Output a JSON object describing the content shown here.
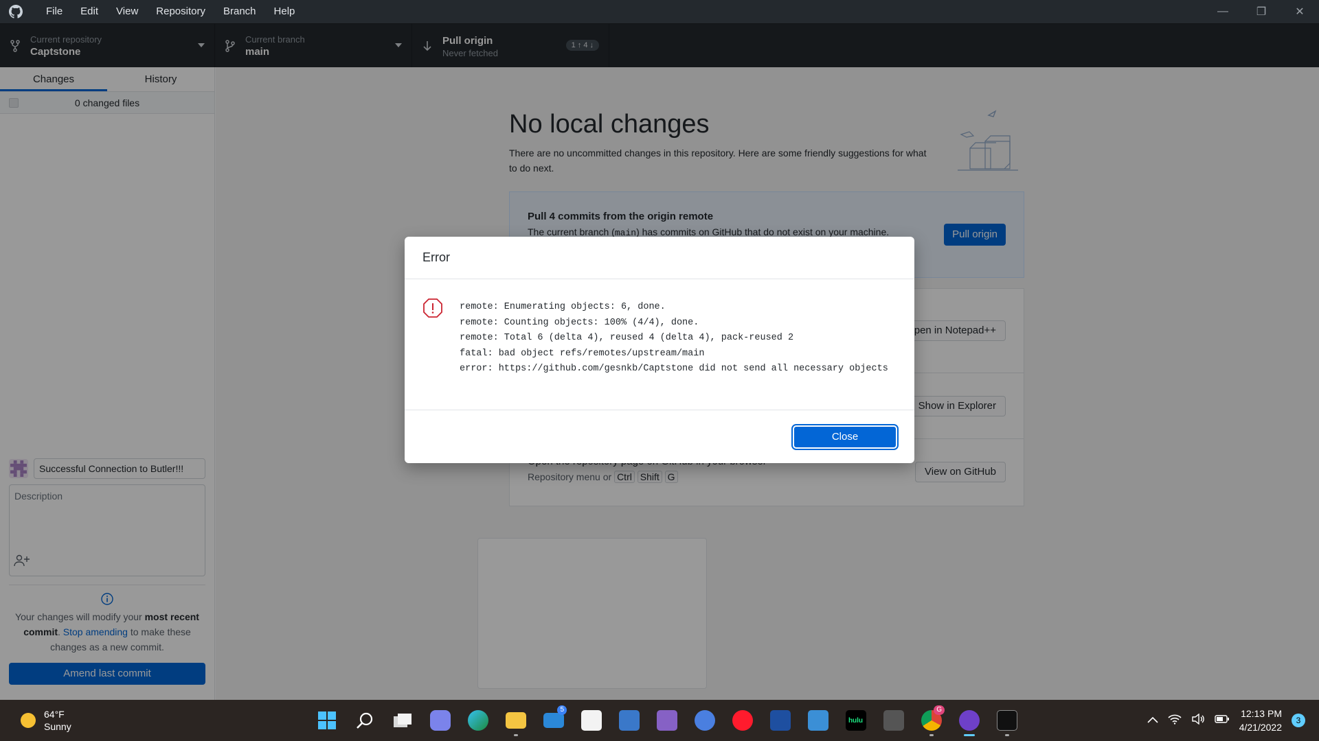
{
  "menu": [
    "File",
    "Edit",
    "View",
    "Repository",
    "Branch",
    "Help"
  ],
  "toolbar": {
    "repo_label": "Current repository",
    "repo_value": "Captstone",
    "branch_label": "Current branch",
    "branch_value": "main",
    "pull_label": "Pull origin",
    "pull_value": "Never fetched",
    "pull_badge": "1 ↑ 4 ↓"
  },
  "sidebar": {
    "tab_changes": "Changes",
    "tab_history": "History",
    "changed_files": "0 changed files",
    "summary_value": "Successful Connection to Butler!!!",
    "description_placeholder": "Description",
    "amend_text_1": "Your changes will modify your ",
    "amend_bold_1": "most recent commit",
    "amend_text_2": ". ",
    "amend_link": "Stop amending",
    "amend_text_3": " to make these changes as a new commit.",
    "amend_button": "Amend last commit"
  },
  "main": {
    "title": "No local changes",
    "lead": "There are no uncommitted changes in this repository. Here are some friendly suggestions for what to do next.",
    "pull_title": "Pull 4 commits from the origin remote",
    "pull_sub_1": "The current branch (",
    "pull_sub_code": "main",
    "pull_sub_2": ") has commits on GitHub that do not exist on your machine.",
    "pull_button": "Pull origin",
    "open_button": "Open in Notepad++",
    "explorer_button": "Show in Explorer",
    "github_title": "Open the repository page on GitHub in your browser",
    "github_sub": "Repository menu or",
    "kbd_ctrl": "Ctrl",
    "kbd_shift": "Shift",
    "kbd_g": "G",
    "github_button": "View on GitHub"
  },
  "dialog": {
    "title": "Error",
    "message": "remote: Enumerating objects: 6, done.\nremote: Counting objects: 100% (4/4), done.\nremote: Total 6 (delta 4), reused 4 (delta 4), pack-reused 2\nfatal: bad object refs/remotes/upstream/main\nerror: https://github.com/gesnkb/Captstone did not send all necessary objects",
    "close_button": "Close"
  },
  "taskbar": {
    "temp": "64°F",
    "condition": "Sunny",
    "time": "12:13 PM",
    "date": "4/21/2022",
    "notifications": "3",
    "mail_badge": "5",
    "chrome_badge": "G",
    "hulu_label": "hulu",
    "apps": [
      "start-icon",
      "search-icon",
      "task-view-icon",
      "teams-icon",
      "edge-icon",
      "file-explorer-icon",
      "mail-icon",
      "store-icon",
      "remote-desktop-icon",
      "visual-studio-icon",
      "chromium-icon",
      "opera-icon",
      "bracket-app-icon",
      "photos-icon",
      "hulu-icon",
      "game-icon",
      "chrome-icon",
      "github-desktop-icon",
      "terminal-icon"
    ]
  }
}
